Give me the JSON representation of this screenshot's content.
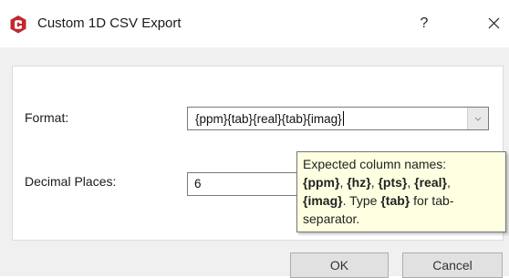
{
  "window": {
    "title": "Custom 1D CSV Export",
    "help_label": "?",
    "icon": "app-logo-icon",
    "close_icon": "close-icon"
  },
  "form": {
    "format_label": "Format:",
    "format_value": "{ppm}{tab}{real}{tab}{imag}",
    "decimal_label": "Decimal Places:",
    "decimal_value": "6"
  },
  "tooltip": {
    "line1": "Expected column names:",
    "line2_name1": "{ppm}",
    "line2_sep1": ", ",
    "line2_name2": "{hz}",
    "line2_sep2": ", ",
    "line2_name3": "{pts}",
    "line2_sep3": ", ",
    "line2_name4": "{real}",
    "line2_sep4": ",",
    "line3_name5": "{imag}",
    "line3_text": ". Type ",
    "line3_tab": "{tab}",
    "line3_tail": " for tab-",
    "line4": "separator."
  },
  "buttons": {
    "ok_label": "OK",
    "cancel_label": "Cancel"
  },
  "colors": {
    "brand_red": "#c0282d",
    "tooltip_bg": "#ffffe1",
    "button_bg": "#e1e1e1"
  }
}
